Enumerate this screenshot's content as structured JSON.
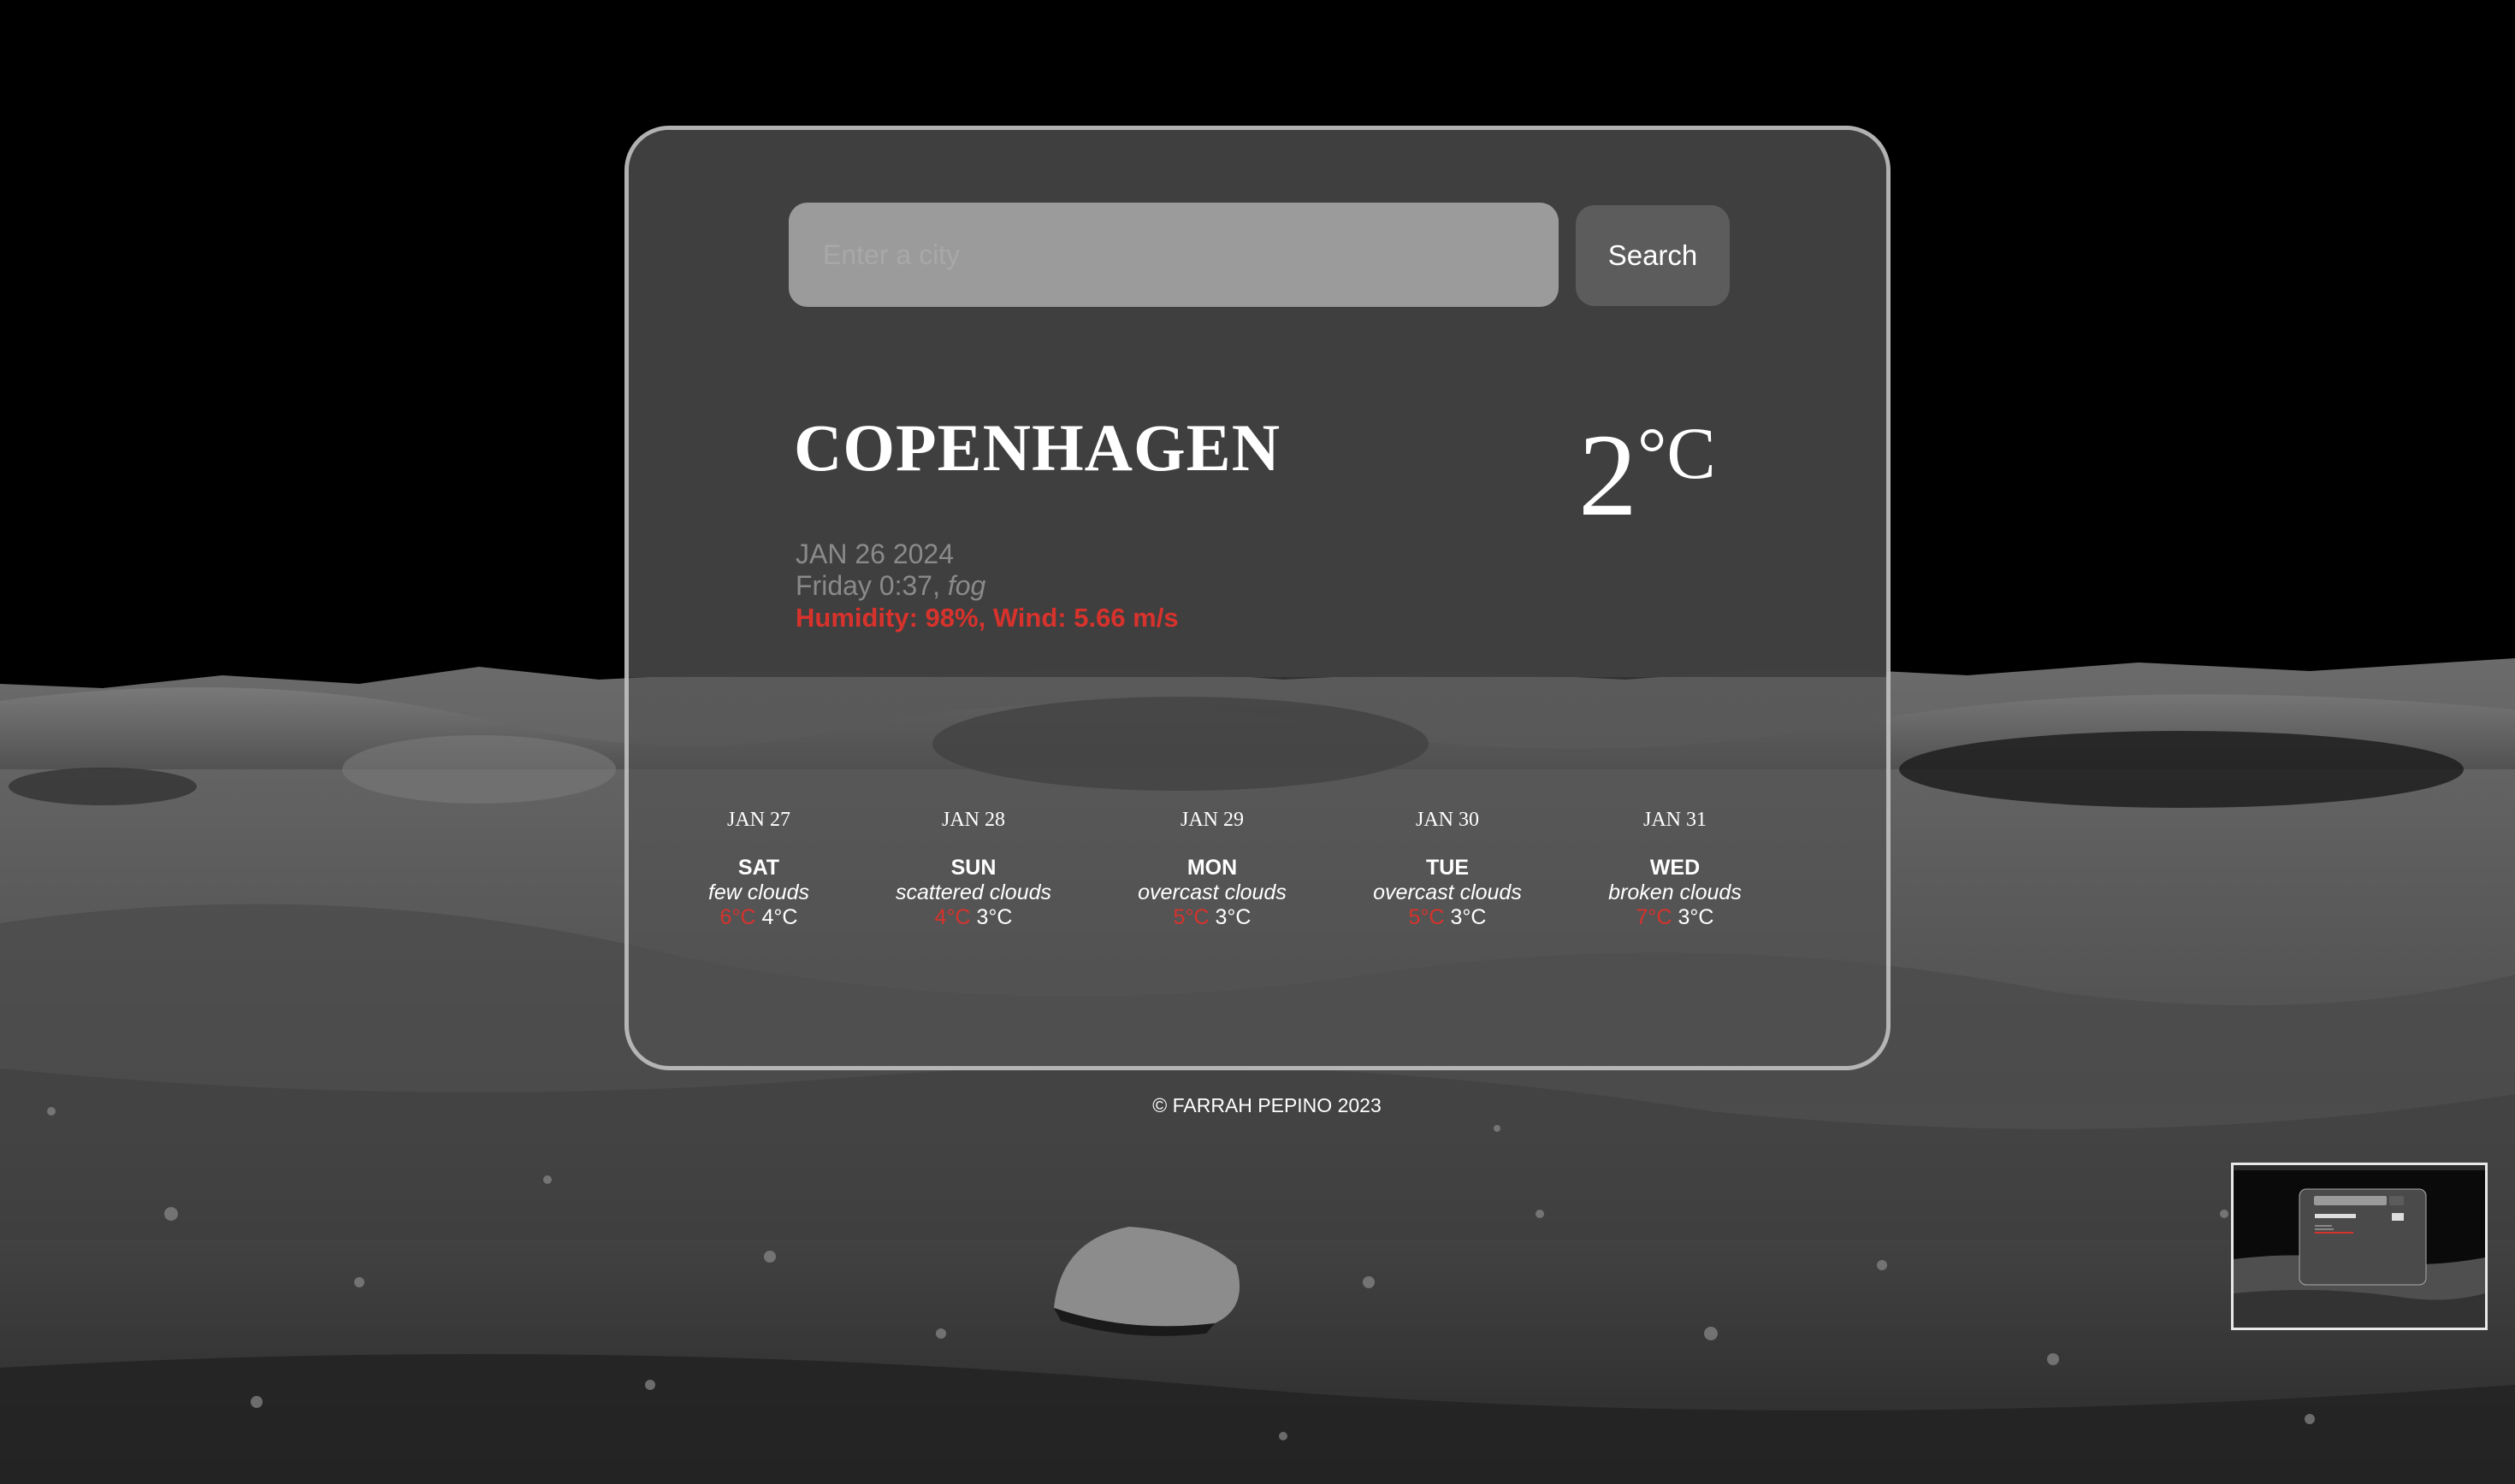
{
  "search": {
    "placeholder": "Enter a city",
    "button_label": "Search"
  },
  "current": {
    "city": "COPENHAGEN",
    "temperature": "2",
    "unit": "°C",
    "date": "JAN 26 2024",
    "time": "Friday 0:37,",
    "condition": "fog",
    "details": "Humidity: 98%, Wind: 5.66 m/s"
  },
  "forecast": [
    {
      "date": "JAN 27",
      "day": "SAT",
      "desc": "few clouds",
      "high": "6°C",
      "low": "4°C"
    },
    {
      "date": "JAN 28",
      "day": "SUN",
      "desc": "scattered clouds",
      "high": "4°C",
      "low": "3°C"
    },
    {
      "date": "JAN 29",
      "day": "MON",
      "desc": "overcast clouds",
      "high": "5°C",
      "low": "3°C"
    },
    {
      "date": "JAN 30",
      "day": "TUE",
      "desc": "overcast clouds",
      "high": "5°C",
      "low": "3°C"
    },
    {
      "date": "JAN 31",
      "day": "WED",
      "desc": "broken clouds",
      "high": "7°C",
      "low": "3°C"
    }
  ],
  "footer": {
    "text": "© FARRAH PEPINO 2023"
  },
  "colors": {
    "accent_red": "#d8322c",
    "card_bg": "#404040",
    "button_bg": "#5c5c5c",
    "input_bg": "#9b9b9b"
  }
}
